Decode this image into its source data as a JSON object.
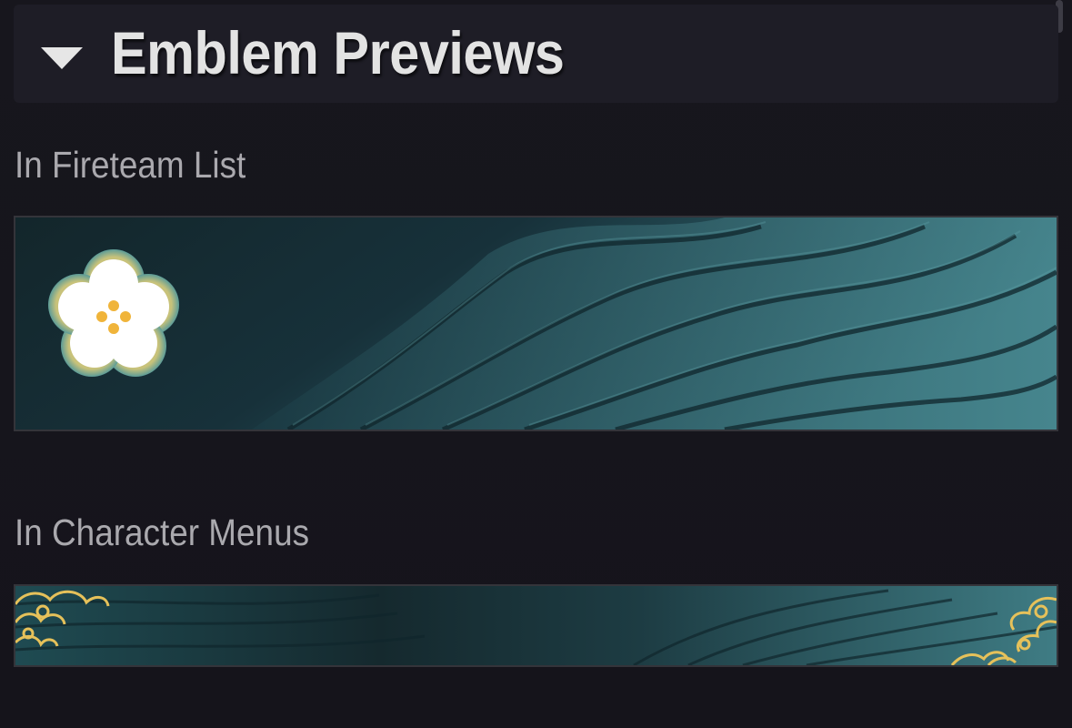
{
  "section": {
    "title": "Emblem Previews",
    "caret_icon": "caret-down-icon",
    "expanded": true
  },
  "previews": {
    "fireteam_label": "In Fireteam List",
    "character_label": "In Character Menus"
  },
  "colors": {
    "background": "#16151c",
    "header_bg": "#1e1d26",
    "title_text": "#e3e3e3",
    "label_text": "#aaa9ae",
    "emblem_teal_dark": "#14272d",
    "emblem_teal_light": "#3f7c84",
    "flower_white": "#ffffff",
    "flower_center": "#f0b43a",
    "gold_accent": "#e6c15a"
  }
}
